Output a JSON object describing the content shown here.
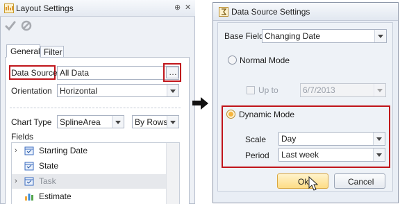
{
  "layout_settings": {
    "title": "Layout Settings",
    "pin_glyph": "⊕",
    "close_glyph": "✕",
    "tabs": [
      {
        "label": "General"
      },
      {
        "label": "Filter"
      }
    ],
    "data_source": {
      "label": "Data Source",
      "value": "All Data",
      "ellipsis": "…"
    },
    "orientation": {
      "label": "Orientation",
      "value": "Horizontal"
    },
    "chart_type": {
      "label": "Chart Type",
      "value": "SplineArea",
      "by_value": "By Rows"
    },
    "fields": {
      "label": "Fields",
      "items": [
        {
          "label": "Starting Date",
          "expander": "›",
          "icon": "date-field-icon"
        },
        {
          "label": "State",
          "expander": "",
          "icon": "date-field-icon"
        },
        {
          "label": "Task",
          "expander": "›",
          "icon": "date-field-icon"
        },
        {
          "label": "Estimate",
          "expander": "",
          "icon": "measure-field-icon"
        }
      ]
    }
  },
  "data_source_settings": {
    "title": "Data Source Settings",
    "base_field": {
      "label": "Base Field",
      "value": "Changing Date"
    },
    "normal_mode": {
      "label": "Normal Mode"
    },
    "up_to": {
      "label": "Up to",
      "value": "6/7/2013"
    },
    "dynamic_mode": {
      "label": "Dynamic Mode"
    },
    "scale": {
      "label": "Scale",
      "value": "Day"
    },
    "period": {
      "label": "Period",
      "value": "Last week"
    },
    "ok_label": "Ok",
    "cancel_label": "Cancel"
  },
  "colors": {
    "highlight": "#c0141a",
    "accent": "#f6b43c"
  }
}
